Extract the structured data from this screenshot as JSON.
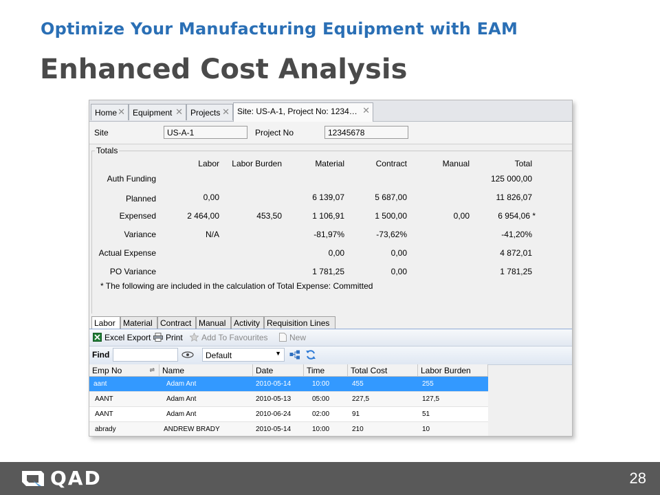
{
  "slide": {
    "subtitle": "Optimize Your Manufacturing Equipment with EAM",
    "title": "Enhanced Cost Analysis",
    "page_number": "28",
    "logo_text": "QAD"
  },
  "tabs": [
    {
      "label": "Home"
    },
    {
      "label": "Equipment"
    },
    {
      "label": "Projects"
    },
    {
      "label": "Site: US-A-1, Project No: 1234…"
    }
  ],
  "header": {
    "site_label": "Site",
    "site_value": "US-A-1",
    "project_label": "Project No",
    "project_value": "12345678"
  },
  "totals": {
    "legend": "Totals",
    "columns": [
      "Labor",
      "Labor Burden",
      "Material",
      "Contract",
      "Manual",
      "Total"
    ],
    "rows": [
      {
        "label": "Auth Funding",
        "values": [
          "",
          "",
          "",
          "",
          "",
          "125 000,00"
        ]
      },
      {
        "label": "Planned",
        "values": [
          "0,00",
          "",
          "6 139,07",
          "5 687,00",
          "",
          "11 826,07"
        ]
      },
      {
        "label": "Expensed",
        "values": [
          "2 464,00",
          "453,50",
          "1 106,91",
          "1 500,00",
          "0,00",
          "6 954,06 *"
        ]
      },
      {
        "label": "Variance",
        "values": [
          "N/A",
          "",
          "-81,97%",
          "-73,62%",
          "",
          "-41,20%"
        ]
      },
      {
        "label": "Actual Expense",
        "values": [
          "",
          "",
          "0,00",
          "0,00",
          "",
          "4 872,01"
        ]
      },
      {
        "label": "PO Variance",
        "values": [
          "",
          "",
          "1 781,25",
          "0,00",
          "",
          "1 781,25"
        ]
      }
    ],
    "note": "* The following are included in the calculation of Total Expense: Committed"
  },
  "bottom_tabs": [
    "Labor",
    "Material",
    "Contract",
    "Manual",
    "Activity",
    "Requisition Lines"
  ],
  "toolbar": {
    "excel_export": "Excel Export",
    "print": "Print",
    "add_to_favourites": "Add To Favourites",
    "new": "New"
  },
  "find": {
    "label": "Find",
    "value": "",
    "view_select": "Default"
  },
  "grid": {
    "columns": [
      "Emp No",
      "Name",
      "Date",
      "Time",
      "Total Cost",
      "Labor Burden"
    ],
    "rows": [
      [
        "aant",
        "Adam Ant",
        "2010-05-14",
        "10:00",
        "455",
        "255"
      ],
      [
        "AANT",
        "Adam Ant",
        "2010-05-13",
        "05:00",
        "227,5",
        "127,5"
      ],
      [
        "AANT",
        "Adam Ant",
        "2010-06-24",
        "02:00",
        "91",
        "51"
      ],
      [
        "abrady",
        "ANDREW BRADY",
        "2010-05-14",
        "10:00",
        "210",
        "10"
      ]
    ]
  },
  "colors": {
    "subtitle": "#2a6fb5",
    "title": "#4a4a4a",
    "selected_row": "#3399ff",
    "footer": "#595959"
  }
}
